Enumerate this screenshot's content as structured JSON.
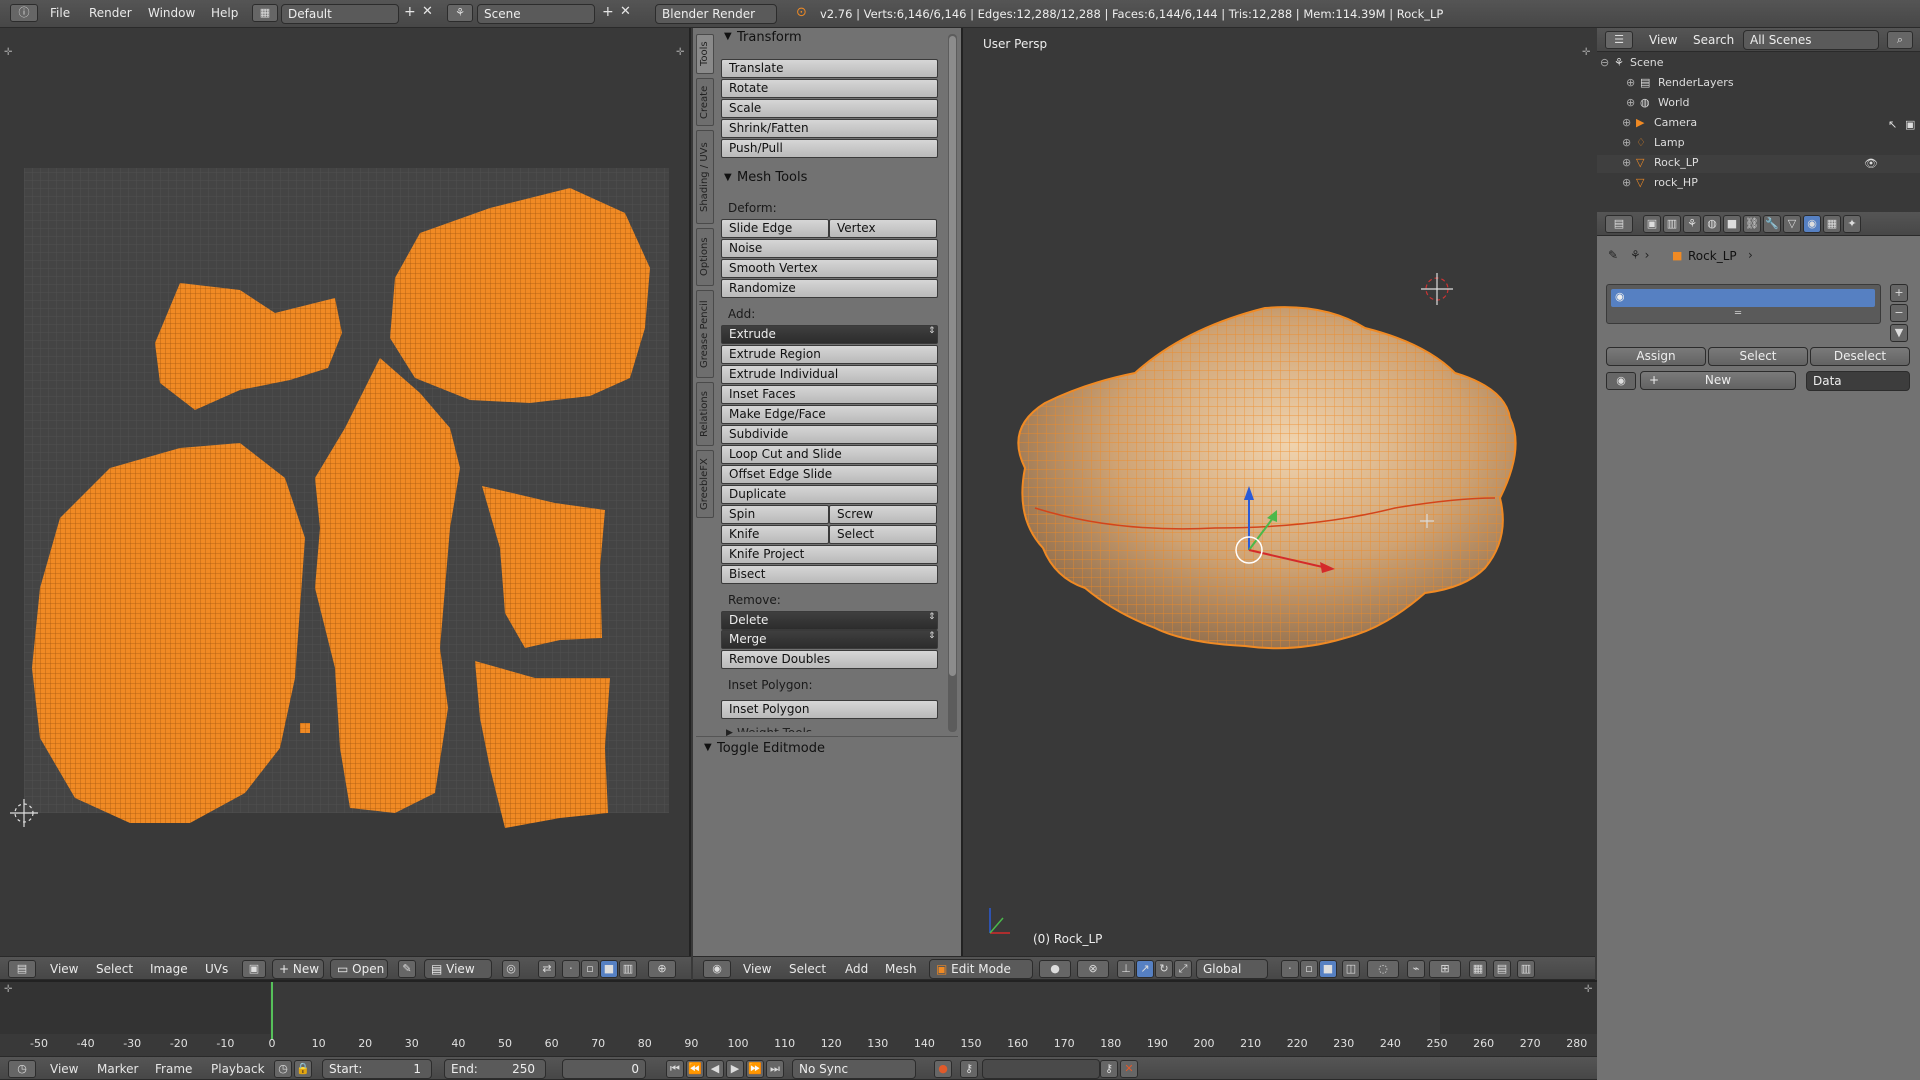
{
  "topbar": {
    "menus": [
      "File",
      "Render",
      "Window",
      "Help"
    ],
    "layout": "Default",
    "scene": "Scene",
    "engine": "Blender Render",
    "stats": "v2.76 | Verts:6,146/6,146 | Edges:12,288/12,288 | Faces:6,144/6,144 | Tris:12,288 | Mem:114.39M | Rock_LP"
  },
  "tool_tabs": [
    "Tools",
    "Create",
    "Shading / UVs",
    "Options",
    "Grease Pencil",
    "Relations",
    "GreebleFX"
  ],
  "toolshelf": {
    "transform_title": "Transform",
    "transform": [
      "Translate",
      "Rotate",
      "Scale",
      "Shrink/Fatten",
      "Push/Pull"
    ],
    "mesh_tools_title": "Mesh Tools",
    "deform_label": "Deform:",
    "slide_edge": "Slide Edge",
    "vertex": "Vertex",
    "deform": [
      "Noise",
      "Smooth Vertex",
      "Randomize"
    ],
    "add_label": "Add:",
    "extrude": "Extrude",
    "add": [
      "Extrude Region",
      "Extrude Individual",
      "Inset Faces",
      "Make Edge/Face",
      "Subdivide",
      "Loop Cut and Slide",
      "Offset Edge Slide",
      "Duplicate"
    ],
    "spin": "Spin",
    "screw": "Screw",
    "knife": "Knife",
    "select": "Select",
    "add2": [
      "Knife Project",
      "Bisect"
    ],
    "remove_label": "Remove:",
    "delete": "Delete",
    "merge": "Merge",
    "remove_doubles": "Remove Doubles",
    "inset_label": "Inset Polygon:",
    "inset_polygon": "Inset Polygon",
    "weight_tools": "Weight Tools",
    "toggle_editmode": "Toggle Editmode"
  },
  "viewport": {
    "label": "User Persp",
    "object_label": "(0) Rock_LP"
  },
  "outliner": {
    "header": [
      "View",
      "Search"
    ],
    "scope": "All Scenes",
    "items": [
      "Scene",
      "RenderLayers",
      "World",
      "Camera",
      "Lamp",
      "Rock_LP",
      "rock_HP"
    ]
  },
  "properties": {
    "object": "Rock_LP",
    "assign": "Assign",
    "select": "Select",
    "deselect": "Deselect",
    "new": "New",
    "data": "Data"
  },
  "uv_header": {
    "menus": [
      "View",
      "Select",
      "Image",
      "UVs"
    ],
    "new": "New",
    "open": "Open",
    "view": "View"
  },
  "view3d_header": {
    "menus": [
      "View",
      "Select",
      "Add",
      "Mesh"
    ],
    "mode": "Edit Mode",
    "orientation": "Global"
  },
  "timeline": {
    "ticks": [
      "-50",
      "-40",
      "-30",
      "-20",
      "-10",
      "0",
      "10",
      "20",
      "30",
      "40",
      "50",
      "60",
      "70",
      "80",
      "90",
      "100",
      "110",
      "120",
      "130",
      "140",
      "150",
      "160",
      "170",
      "180",
      "190",
      "200",
      "210",
      "220",
      "230",
      "240",
      "250",
      "260",
      "270",
      "280"
    ],
    "menus": [
      "View",
      "Marker",
      "Frame",
      "Playback"
    ],
    "start": "Start:",
    "start_val": "1",
    "end": "End:",
    "end_val": "250",
    "current": "0",
    "sync": "No Sync"
  },
  "colors": {
    "accent": "#f08a24",
    "selection": "#5680c2"
  }
}
